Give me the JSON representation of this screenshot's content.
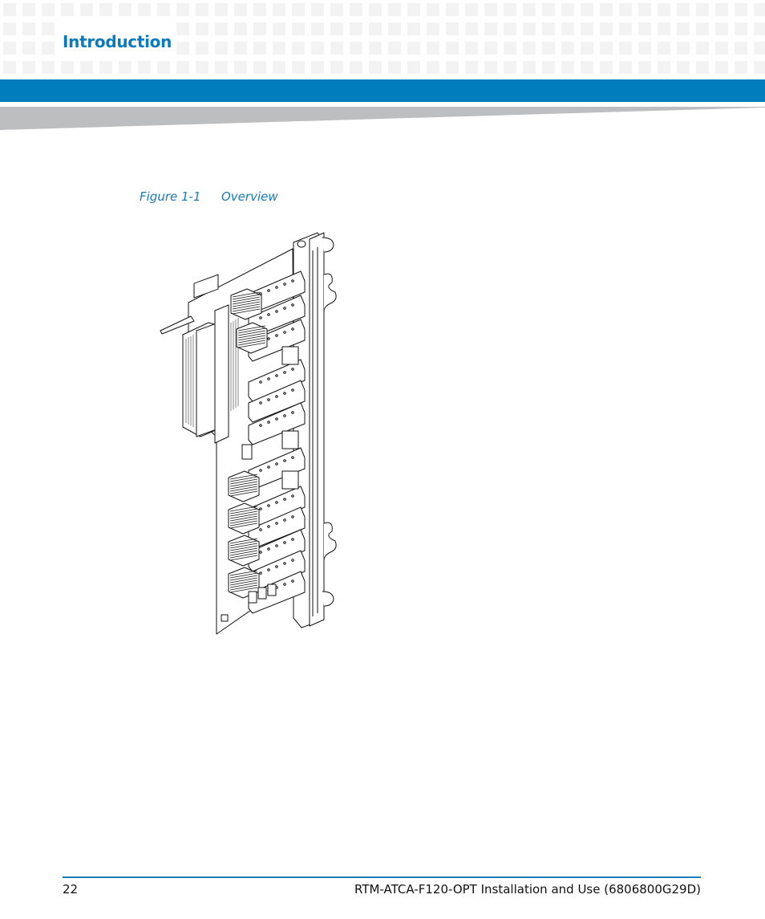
{
  "header": {
    "section_title": "Introduction",
    "accent_color": "#007dbd",
    "title_color": "#0a7cbd"
  },
  "figure": {
    "number": "Figure 1-1",
    "title": "Overview",
    "image_description": "Line drawing of RTM-ATCA-F120-OPT rear transition module board with front panel, SFP cages, heat sinks and backplane connector"
  },
  "footer": {
    "page_number": "22",
    "document_title": "RTM-ATCA-F120-OPT Installation and Use (6806800G29D)"
  }
}
